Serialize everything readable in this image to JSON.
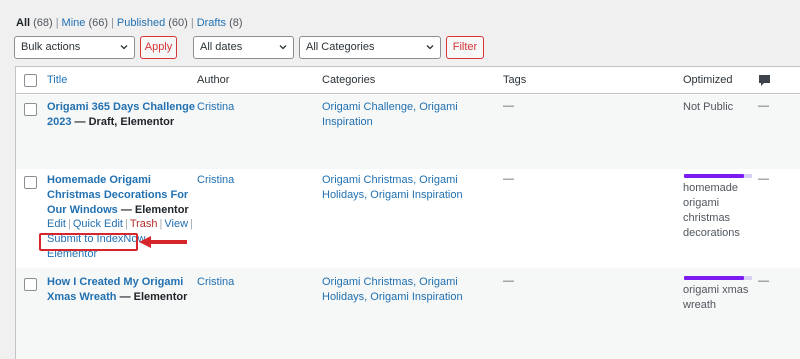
{
  "views": {
    "all_label": "All",
    "all_count": "(68)",
    "mine_label": "Mine",
    "mine_count": "(66)",
    "published_label": "Published",
    "published_count": "(60)",
    "drafts_label": "Drafts",
    "drafts_count": "(8)",
    "separator": "|"
  },
  "filters": {
    "bulk_actions": "Bulk actions",
    "apply": "Apply",
    "dates": "All dates",
    "categories": "All Categories",
    "filter": "Filter"
  },
  "columns": {
    "title": "Title",
    "author": "Author",
    "categories": "Categories",
    "tags": "Tags",
    "optimized": "Optimized",
    "comments_icon": "comment-bubble-icon"
  },
  "rows": [
    {
      "title": "Origami 365 Days Challenge 2023",
      "state": "— Draft, Elementor",
      "author": "Cristina",
      "categories": "Origami Challenge, Origami Inspiration",
      "tags": "—",
      "optimized": "Not Public",
      "comments": "—"
    },
    {
      "title": "Homemade Origami Christmas Decorations For Our Windows",
      "state": "— Elementor",
      "author": "Cristina",
      "categories": "Origami Christmas, Origami Holidays, Origami Inspiration",
      "tags": "—",
      "optimized": "homemade origami christmas decorations",
      "comments": "—",
      "actions": {
        "edit": "Edit",
        "quick_edit": "Quick Edit",
        "trash": "Trash",
        "view": "View",
        "indexnow": "Submit to IndexNow",
        "elementor": "Elementor"
      }
    },
    {
      "title": "How I Created My Origami Xmas Wreath",
      "state": "— Elementor",
      "author": "Cristina",
      "categories": "Origami Christmas, Origami Holidays, Origami Inspiration",
      "tags": "—",
      "optimized": "origami xmas wreath",
      "comments": "—"
    }
  ],
  "colors": {
    "link": "#2271b1",
    "highlight_red": "#d6262c",
    "keyword_bar": "#7d1cf2"
  }
}
